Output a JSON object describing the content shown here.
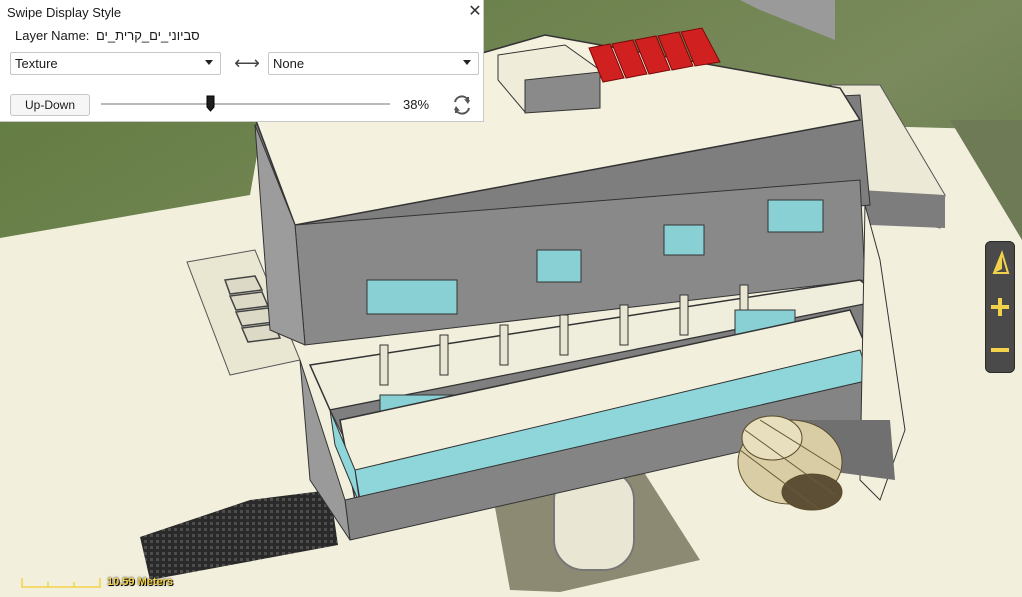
{
  "panel": {
    "title": "Swipe Display Style",
    "layer_label": "Layer Name:",
    "layer_value": "סביוני_ים_קרית_ים",
    "left_select": "Texture",
    "right_select": "None",
    "mode_button": "Up-Down",
    "slider_percent_label": "38%",
    "slider_value": 0.38,
    "icons": {
      "close": "close-icon",
      "swap": "swap-arrows-icon",
      "refresh": "refresh-icon"
    }
  },
  "navigation": {
    "icons": [
      "compass-north-icon",
      "zoom-in-icon",
      "zoom-out-icon"
    ],
    "accent_color": "#f2d24a"
  },
  "scale_bar": {
    "label": "10.59 Meters"
  }
}
